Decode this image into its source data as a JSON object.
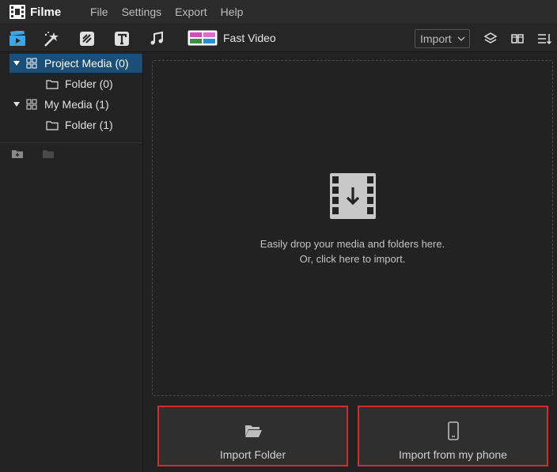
{
  "app": {
    "name": "Filme"
  },
  "menu": [
    "File",
    "Settings",
    "Export",
    "Help"
  ],
  "toolbar": {
    "tools": [
      "media-icon",
      "effects-icon",
      "transitions-icon",
      "text-icon",
      "audio-icon"
    ],
    "fast_video_label": "Fast Video",
    "import_select": "Import"
  },
  "sidebar": {
    "tree": [
      {
        "label": "Project Media (0)",
        "selected": true
      },
      {
        "label": "Folder (0)"
      },
      {
        "label": "My Media (1)"
      },
      {
        "label": "Folder (1)"
      }
    ]
  },
  "dropzone": {
    "line1": "Easily drop your media and folders here.",
    "line2": "Or, click here to import."
  },
  "buttons": {
    "import_folder": "Import Folder",
    "import_phone": "Import from my phone"
  },
  "colors": {
    "selected_bg": "#1b4f77",
    "accent_blue": "#3ba7e8",
    "highlight_red": "#d42b2b"
  }
}
